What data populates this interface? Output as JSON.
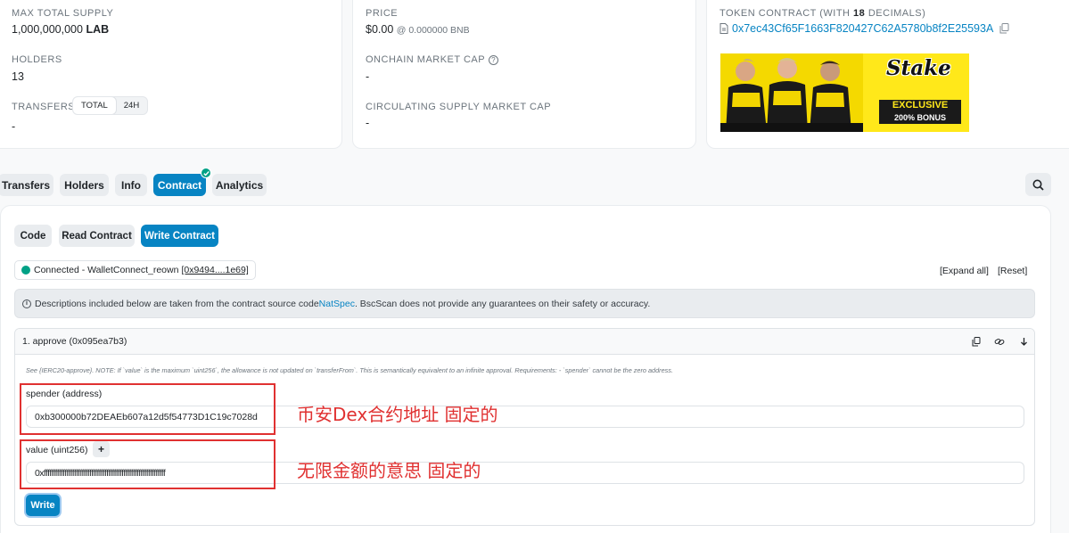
{
  "overview": {
    "max_supply_label": "MAX TOTAL SUPPLY",
    "max_supply_value": "1,000,000,000",
    "max_supply_symbol": "LAB",
    "holders_label": "HOLDERS",
    "holders_value": "13",
    "transfers_label": "TRANSFERS",
    "transfers_toggle": [
      "TOTAL",
      "24H"
    ],
    "transfers_value": "-"
  },
  "market": {
    "price_label": "PRICE",
    "price_value": "$0.00",
    "price_sub": "@ 0.000000 BNB",
    "onchain_cap_label": "ONCHAIN MARKET CAP",
    "onchain_cap_value": "-",
    "circ_cap_label": "CIRCULATING SUPPLY MARKET CAP",
    "circ_cap_value": "-"
  },
  "other": {
    "contract_label_pre": "TOKEN CONTRACT (WITH ",
    "contract_decimals": "18",
    "contract_label_post": " DECIMALS)",
    "contract_address": "0x7ec43Cf65F1663F820427C62A5780b8f2E25593A",
    "ad": {
      "brand": "Stake",
      "badge_line1": "EXCLUSIVE",
      "badge_line2": "200% BONUS"
    }
  },
  "tabs": [
    "Transfers",
    "Holders",
    "Info",
    "Contract",
    "Analytics"
  ],
  "subtabs": [
    "Code",
    "Read Contract",
    "Write Contract"
  ],
  "connection": {
    "status_text": "Connected - WalletConnect_reown ",
    "address": "[0x9494....1e69]",
    "expand_all": "[Expand all]",
    "reset": "[Reset]"
  },
  "notice": {
    "text_pre": "Descriptions included below are taken from the contract source code ",
    "natspec": "NatSpec",
    "text_post": ". BscScan does not provide any guarantees on their safety or accuracy."
  },
  "method": {
    "title": "1. approve (0x095ea7b3)",
    "description": "See {IERC20-approve}. NOTE: If `value` is the maximum `uint256`, the allowance is not updated on `transferFrom`. This is semantically equivalent to an infinite approval. Requirements: - `spender` cannot be the zero address.",
    "spender_label": "spender (address)",
    "spender_value": "0xb300000b72DEAEb607a12d5f54773D1C19c7028d",
    "value_label": "value (uint256)",
    "value_plus": "+",
    "value_value": "0xffffffffffffffffffffffffffffffffffffffffffffffffffffffffffffffff",
    "write_button": "Write"
  },
  "annotations": {
    "spender_note": "币安Dex合约地址 固定的",
    "value_note": "无限金额的意思 固定的"
  },
  "colors": {
    "accent": "#0784c3",
    "connected": "#00a186",
    "annotation": "#e03131",
    "ad_yellow": "#ffe81a"
  }
}
